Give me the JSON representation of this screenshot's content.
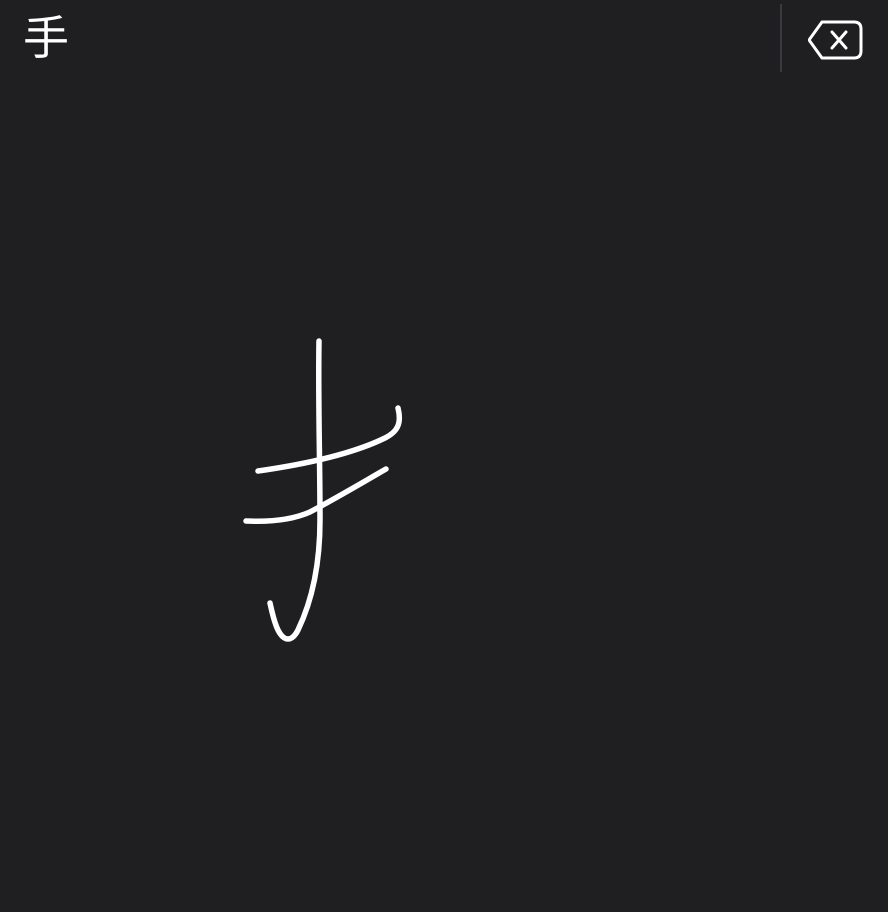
{
  "candidates": {
    "first": "手"
  },
  "icons": {
    "delete": "delete-backward-icon"
  },
  "colors": {
    "background": "#1f1e21",
    "stroke": "#ffffff",
    "divider": "#3a393d"
  }
}
